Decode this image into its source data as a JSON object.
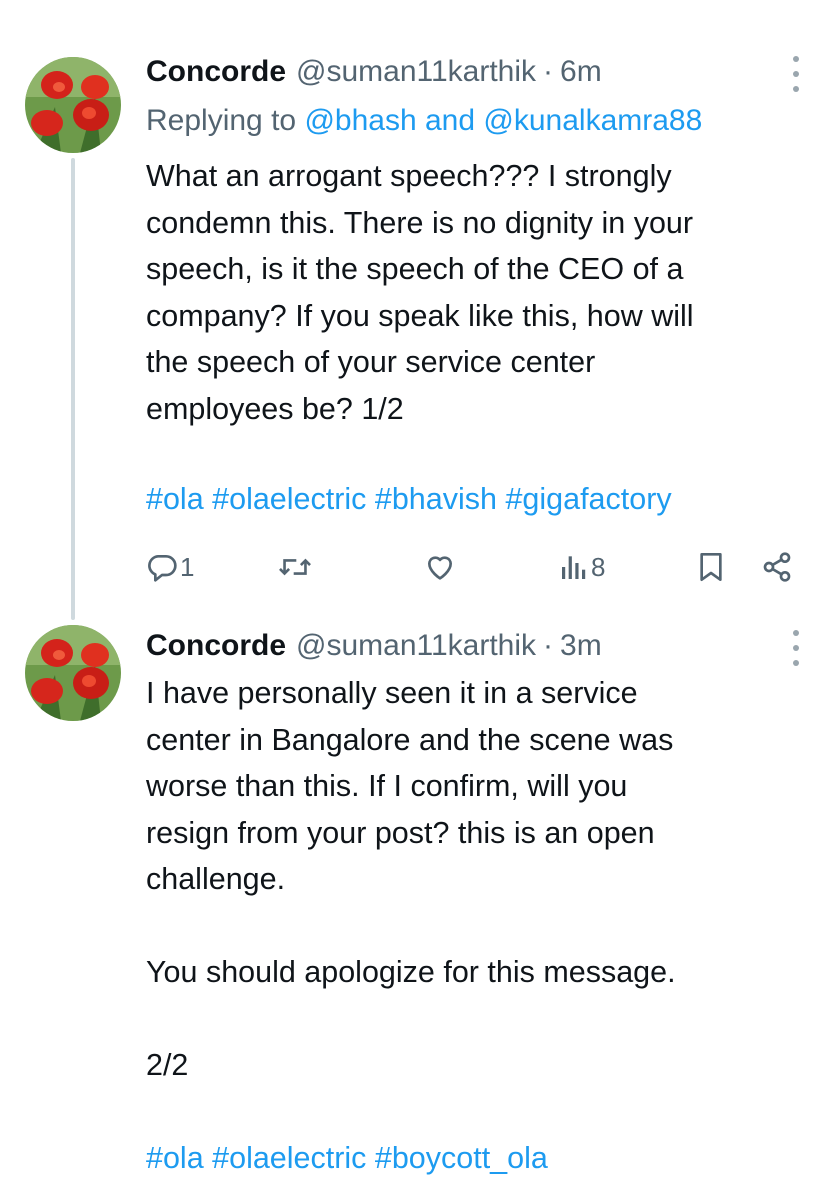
{
  "tweets": [
    {
      "name": "Concorde",
      "handle": "@suman11karthik",
      "separator": "·",
      "time": "6m",
      "replying_prefix": "Replying to",
      "replying_user_1": "@bhash",
      "replying_and": "and",
      "replying_user_2": "@kunalkamra88",
      "lines": [
        "What an arrogant speech???  I strongly",
        "condemn this.  There is no dignity in your",
        "speech, is it the speech of the CEO of a",
        "company? If you speak like this, how will",
        "the speech of your service center",
        "employees be?  1/2"
      ],
      "hashtags": "#ola #olaelectric #bhavish #gigafactory",
      "reply_count": "1",
      "views_count": "8"
    },
    {
      "name": "Concorde",
      "handle": "@suman11karthik",
      "separator": "·",
      "time": "3m",
      "lines": [
        "I have personally seen it in a service",
        "center in Bangalore and the scene was",
        "worse than this. If I confirm, will you",
        "resign from your post?  this is an open",
        "challenge.",
        "",
        "You should apologize for this message.",
        "",
        "2/2",
        ""
      ],
      "hashtags": "#ola #olaelectric #boycott_ola"
    }
  ],
  "icons": {
    "reply": "reply-icon",
    "retweet": "retweet-icon",
    "like": "heart-icon",
    "views": "views-icon",
    "bookmark": "bookmark-icon",
    "share": "share-icon",
    "more": "more-dots-icon"
  },
  "colors": {
    "link": "#1d9bf0",
    "secondary_text": "#536471",
    "primary_text": "#0f1419",
    "thread_line": "#cfd9de"
  }
}
